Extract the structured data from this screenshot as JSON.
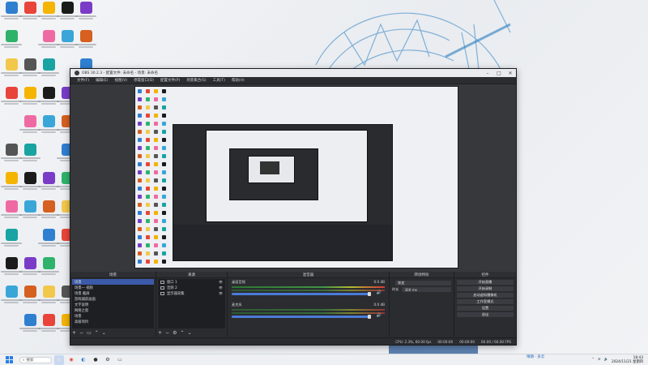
{
  "window": {
    "title": "OBS 30.2.3 - 配置文件: 未命名 - 场景: 未命名",
    "menu": [
      "文件(F)",
      "编辑(E)",
      "视图(V)",
      "停靠窗口(D)",
      "配置文件(P)",
      "场景集合(S)",
      "工具(T)",
      "帮助(H)"
    ]
  },
  "docks": {
    "scenes_title": "场景",
    "scenes": [
      "场景",
      "场景一 视频",
      "场景 截屏",
      "游戏捕获画面",
      "文字说明",
      "网络之窗",
      "场景",
      "高级项目"
    ],
    "sources_title": "来源",
    "sources": [
      "窗口 1",
      "音频 2",
      "显示器采集"
    ],
    "mixer_title": "混音器",
    "mixer": [
      {
        "name": "桌面音频",
        "level": "0.0 dB"
      },
      {
        "name": "麦克风",
        "level": "0.0 dB"
      }
    ],
    "transitions_title": "转场特效",
    "transition_value": "渐变",
    "duration_label": "时长",
    "duration_value": "300 ms",
    "controls_title": "控件",
    "controls": [
      "开始直播",
      "开始录制",
      "启动虚拟摄像机",
      "工作室模式",
      "设置",
      "退出"
    ]
  },
  "status": {
    "cpu": "CPU: 2.3%, 60.00 fps",
    "time1": "00:00:00",
    "time2": "00:00:00",
    "fps": "60.00 / 60.00 FPS"
  },
  "taskbar": {
    "search": "搜索",
    "weather": "晴朗 · 多云",
    "time": "18:43",
    "date": "2024/11/21 星期四"
  },
  "colors": {
    "obs_bg": "#2b2c30",
    "selection": "#3b5aa8",
    "accent": "#4a7bd6"
  },
  "icons": [
    "start-icon",
    "search-icon",
    "edge-icon",
    "chrome-icon",
    "obs-icon",
    "steam-icon",
    "wifi-icon",
    "volume-icon"
  ]
}
